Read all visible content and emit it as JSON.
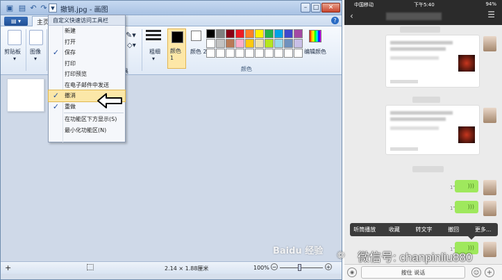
{
  "paint": {
    "window_title": "撤销.jpg - 画图",
    "tabs": {
      "home": "主页"
    },
    "ribbon": {
      "clipboard_label": "剪贴板",
      "image_label": "图像",
      "tools_partial": "具",
      "size_label": "粗细",
      "color1_label": "颜色 1",
      "color2_label": "颜色 2",
      "colors_group_label": "颜色",
      "edit_colors_label": "编辑颜色",
      "palette": [
        "#000000",
        "#7f7f7f",
        "#880015",
        "#ed1c24",
        "#ff7f27",
        "#fff200",
        "#22b14c",
        "#00a2e8",
        "#3f48cc",
        "#a349a4",
        "#ffffff",
        "#c3c3c3",
        "#b97a57",
        "#ffaec9",
        "#ffc90e",
        "#efe4b0",
        "#b5e61d",
        "#99d9ea",
        "#7092be",
        "#c8bfe7",
        "#ffffff",
        "#ffffff",
        "#ffffff",
        "#ffffff",
        "#ffffff",
        "#ffffff",
        "#ffffff",
        "#ffffff",
        "#ffffff",
        "#ffffff"
      ]
    },
    "qat_menu": {
      "header": "自定义快速访问工具栏",
      "items": [
        {
          "label": "新建",
          "checked": false
        },
        {
          "label": "打开",
          "checked": false
        },
        {
          "label": "保存",
          "checked": true
        },
        {
          "label": "打印",
          "checked": false
        },
        {
          "label": "打印预览",
          "checked": false
        },
        {
          "label": "在电子邮件中发送",
          "checked": false
        },
        {
          "label": "撤消",
          "checked": true
        },
        {
          "label": "重做",
          "checked": true
        },
        {
          "label": "在功能区下方显示(S)",
          "checked": false
        },
        {
          "label": "最小化功能区(N)",
          "checked": false
        }
      ]
    },
    "status": {
      "image_size": "2.14 × 1.88厘米",
      "zoom": "100%"
    }
  },
  "phone": {
    "carrier": "中国移动",
    "time": "下午5:40",
    "battery": "94%",
    "context_menu": [
      "听筒播放",
      "收藏",
      "转文字",
      "撤回",
      "更多..."
    ],
    "input_hold_to_talk": "按住 说话",
    "voice_durations": [
      "1\"",
      "1\"",
      "1\""
    ]
  },
  "watermarks": {
    "baidu": "Baidu 经验",
    "wechat": "微信号: chanpinliu880"
  },
  "colors": {
    "accent_highlight": "#fbe7a8",
    "voice_bubble": "#9fe85d"
  }
}
